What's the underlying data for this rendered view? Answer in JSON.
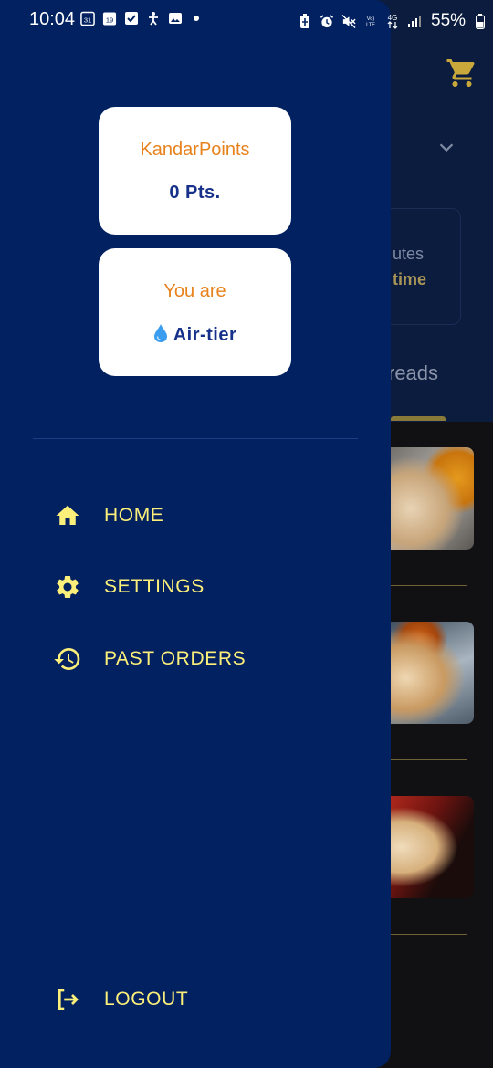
{
  "status_bar": {
    "time": "10:04",
    "battery": "55%",
    "icons_left": [
      "calendar-icon",
      "calendar-date-icon",
      "checkbox-icon",
      "accessibility-icon",
      "gallery-icon",
      "dot-icon"
    ],
    "icons_right": [
      "battery-saver-icon",
      "alarm-icon",
      "mute-icon",
      "volte-icon",
      "4g-icon",
      "signal-icon",
      "battery-icon"
    ],
    "calendar_day_1": "31",
    "calendar_day_2": "19",
    "volte_label": "Vo) LTE",
    "network_label": "4G"
  },
  "background": {
    "card_line1": "utes",
    "card_line2": "time",
    "tab_label": "reads",
    "colors": {
      "header_bg": "#0b1c3f",
      "accent": "#c8a83a"
    }
  },
  "drawer": {
    "points_card": {
      "title": "KandarPoints",
      "value": "0 Pts."
    },
    "tier_card": {
      "title": "You are",
      "value": "Air-tier",
      "icon": "droplet-icon"
    },
    "menu": [
      {
        "label": "HOME",
        "icon": "home-icon"
      },
      {
        "label": "SETTINGS",
        "icon": "gear-icon"
      },
      {
        "label": "PAST ORDERS",
        "icon": "history-icon"
      }
    ],
    "logout": {
      "label": "LOGOUT",
      "icon": "logout-icon"
    },
    "colors": {
      "drawer_bg": "#022160",
      "menu_text": "#fdf07a",
      "card_title": "#e8821d",
      "card_value": "#17318b"
    }
  }
}
